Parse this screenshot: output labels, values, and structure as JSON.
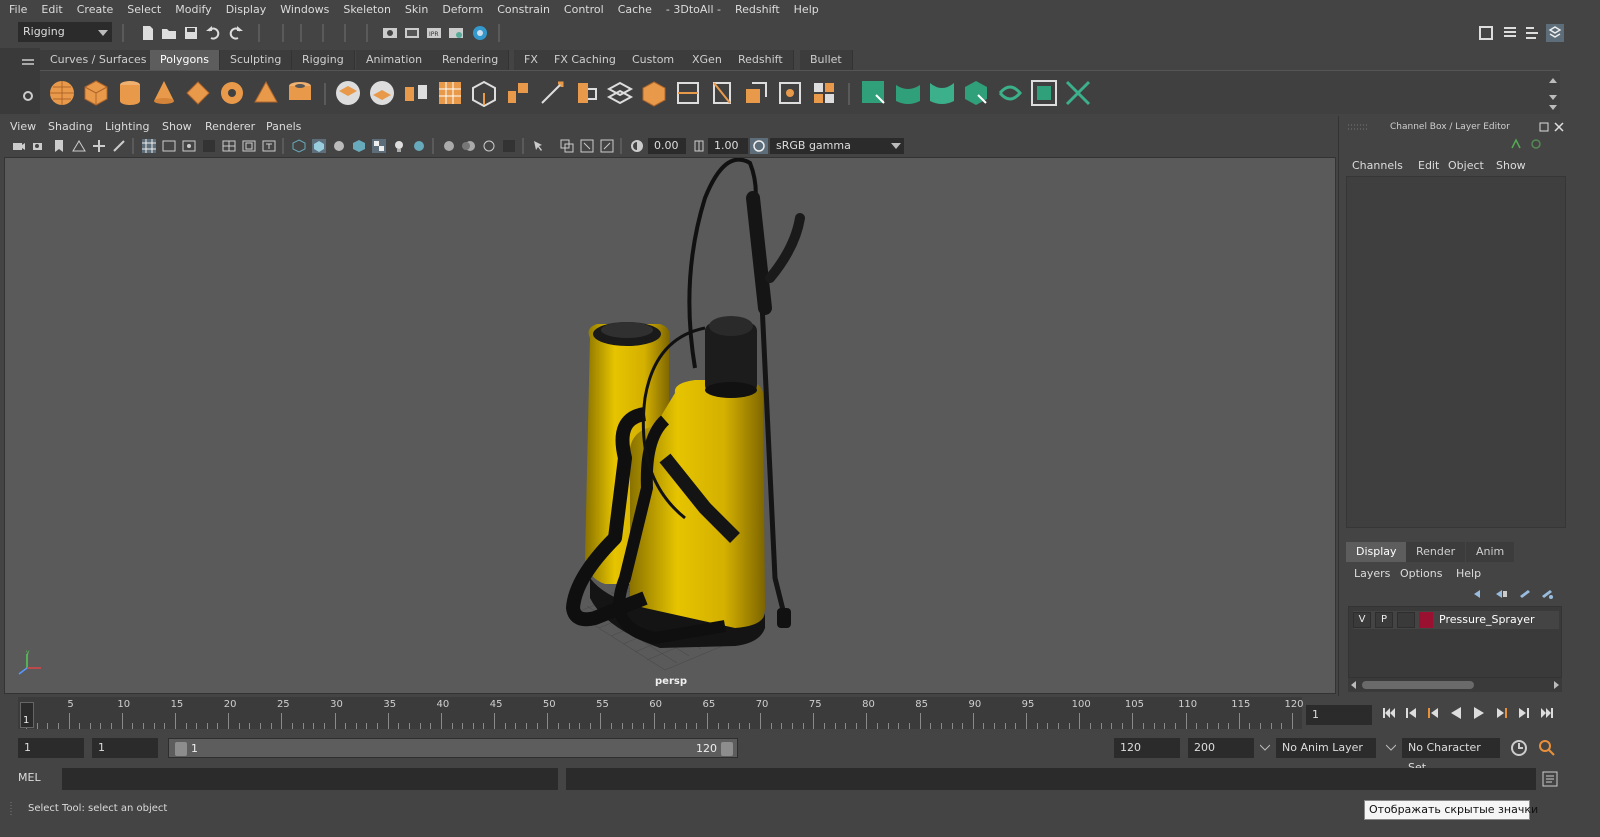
{
  "menubar": {
    "items": [
      "File",
      "Edit",
      "Create",
      "Select",
      "Modify",
      "Display",
      "Windows",
      "Skeleton",
      "Skin",
      "Deform",
      "Constrain",
      "Control",
      "Cache",
      "- 3DtoAll -",
      "Redshift",
      "Help"
    ]
  },
  "statusline": {
    "menuset": "Rigging"
  },
  "shelf": {
    "tabs": [
      "Curves / Surfaces",
      "Polygons",
      "Sculpting",
      "Rigging",
      "Animation",
      "Rendering",
      "FX",
      "FX Caching",
      "Custom",
      "XGen",
      "Redshift",
      "Bullet"
    ],
    "active_tab": "Polygons"
  },
  "viewport": {
    "menus": [
      "View",
      "Shading",
      "Lighting",
      "Show",
      "Renderer",
      "Panels"
    ],
    "exposure": "0.00",
    "gamma": "1.00",
    "color_space": "sRGB gamma",
    "camera": "persp"
  },
  "channel_box": {
    "title": "Channel Box / Layer Editor",
    "menus": [
      "Channels",
      "Edit",
      "Object",
      "Show"
    ]
  },
  "layer_editor": {
    "tabs": [
      "Display",
      "Render",
      "Anim"
    ],
    "active_tab": "Display",
    "menus": [
      "Layers",
      "Options",
      "Help"
    ],
    "layer": {
      "visible": "V",
      "playback": "P",
      "color": "#9a1030",
      "name": "Pressure_Sprayer"
    }
  },
  "timeline": {
    "start": 1,
    "end": 120,
    "labels": [
      "5",
      "10",
      "15",
      "20",
      "25",
      "30",
      "35",
      "40",
      "45",
      "50",
      "55",
      "60",
      "65",
      "70",
      "75",
      "80",
      "85",
      "90",
      "95",
      "100",
      "105",
      "110",
      "115",
      "120"
    ],
    "current_frame_label": "1",
    "current_frame_field": "1"
  },
  "range": {
    "start_field": "1",
    "playback_start_field": "1",
    "slider_start_label": "1",
    "slider_end_label": "120",
    "playback_end_field": "120",
    "end_field": "200",
    "anim_layer": "No Anim Layer",
    "character_set": "No Character Set"
  },
  "command_line": {
    "label": "MEL",
    "help_text": "Select Tool: select an object",
    "tooltip": "Отображать скрытые значки"
  }
}
